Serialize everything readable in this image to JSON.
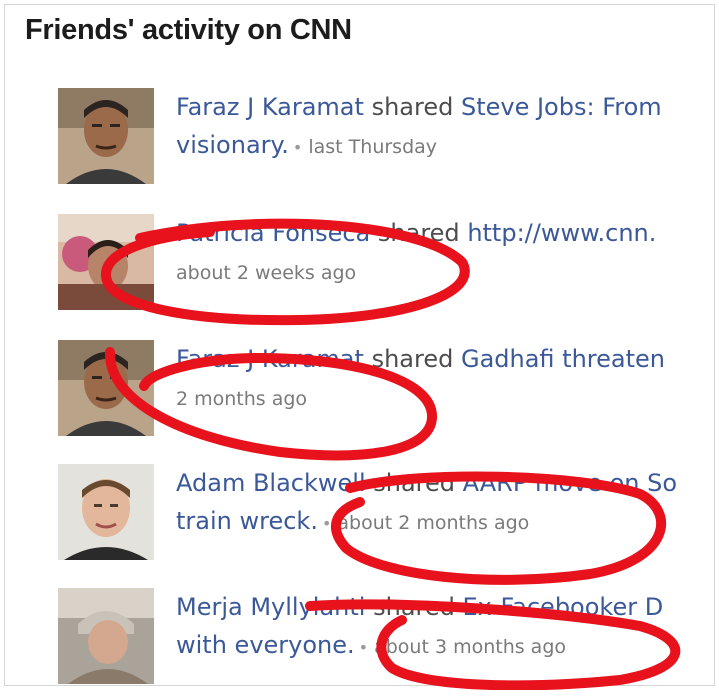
{
  "heading": "Friends' activity on CNN",
  "items": [
    {
      "name": "Faraz J Karamat",
      "verb": "shared",
      "link_line1": "Steve Jobs: From",
      "link_line2": "visionary.",
      "time": "last Thursday"
    },
    {
      "name": "Patricia Fonseca",
      "verb": "shared",
      "link_line1": "http://www.cnn.",
      "link_line2": "",
      "time": "about 2 weeks ago"
    },
    {
      "name": "Faraz J Karamat",
      "verb": "shared",
      "link_line1": "Gadhafi threaten",
      "link_line2": "",
      "time": "2 months ago"
    },
    {
      "name": "Adam Blackwell",
      "verb": "shared",
      "link_line1": "AARP move on So",
      "link_line2": "train wreck.",
      "time": "about 2 months ago"
    },
    {
      "name": "Merja Myllylahti",
      "verb": "shared",
      "link_line1": "Ex-Facebooker D",
      "link_line2": "with everyone.",
      "time": "about 3 months ago"
    }
  ],
  "annotation_color": "#e8121c"
}
